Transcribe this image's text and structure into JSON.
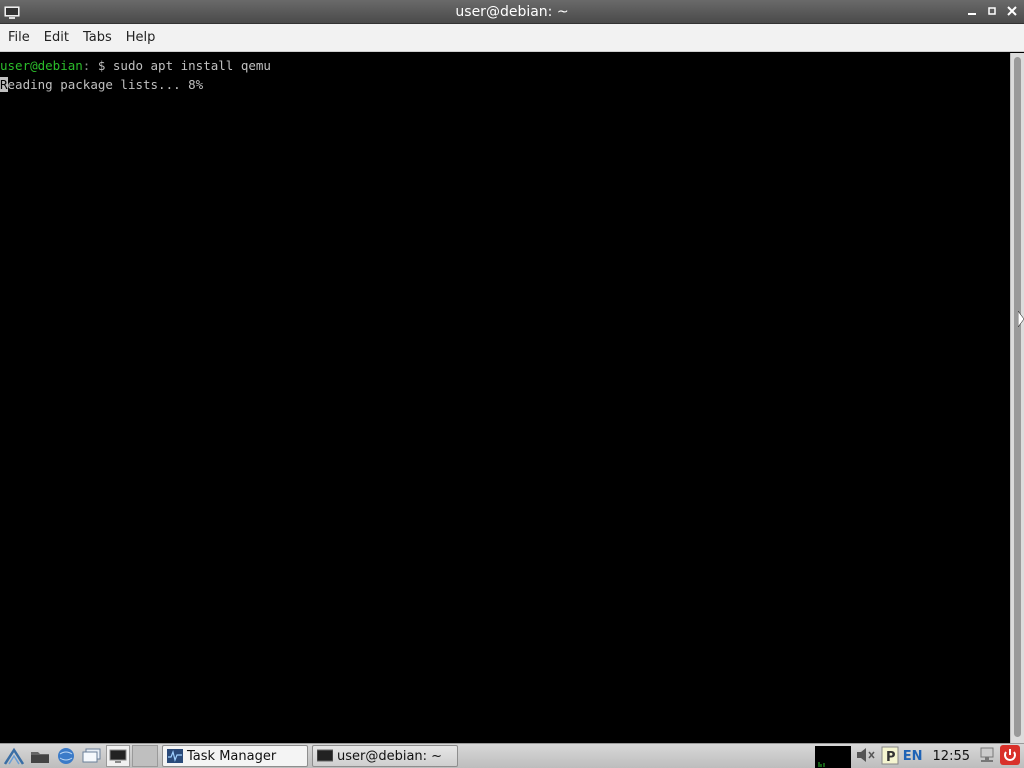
{
  "window": {
    "title": "user@debian: ~",
    "buttons": {
      "minimize": "▁",
      "maximize": "▫",
      "close": "✕"
    }
  },
  "menu": {
    "items": [
      "File",
      "Edit",
      "Tabs",
      "Help"
    ]
  },
  "terminal": {
    "prompt_user": "user@debian",
    "prompt_sep": ":",
    "prompt_rest": " $ sudo apt install qemu",
    "output_cursor_char": "R",
    "output_rest": "eading package lists... 8%"
  },
  "taskbar": {
    "tasks": [
      {
        "label": "Task Manager",
        "state": "active"
      },
      {
        "label": "user@debian: ~",
        "state": "inactive"
      }
    ],
    "lang": "EN",
    "clock": "12:55"
  },
  "colors": {
    "prompt_user": "#2bbd2b",
    "terminal_bg": "#000000",
    "terminal_fg": "#c0c0c0"
  }
}
